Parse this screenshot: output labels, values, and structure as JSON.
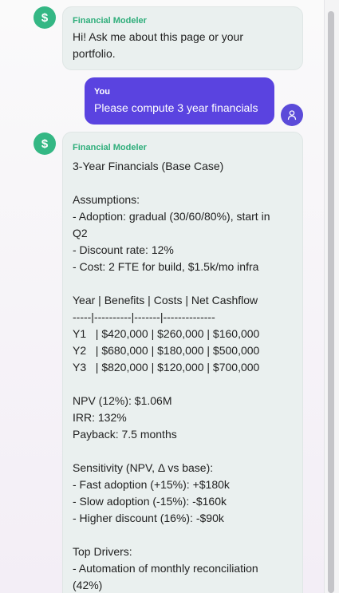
{
  "messages": [
    {
      "role": "assistant",
      "sender": "Financial Modeler",
      "avatar_icon": "dollar-sign-icon",
      "avatar_glyph": "$",
      "text": "Hi! Ask me about this page or your\nportfolio."
    },
    {
      "role": "user",
      "sender": "You",
      "avatar_icon": "user-icon",
      "text": "Please compute 3 year financials"
    },
    {
      "role": "assistant",
      "sender": "Financial Modeler",
      "avatar_icon": "dollar-sign-icon",
      "avatar_glyph": "$",
      "text": "3-Year Financials (Base Case)\n\nAssumptions:\n- Adoption: gradual (30/60/80%), start in\nQ2\n- Discount rate: 12%\n- Cost: 2 FTE for build, $1.5k/mo infra\n\nYear | Benefits | Costs | Net Cashflow\n-----|----------|-------|--------------\nY1   | $420,000 | $260,000 | $160,000\nY2   | $680,000 | $180,000 | $500,000\nY3   | $820,000 | $120,000 | $700,000\n\nNPV (12%): $1.06M\nIRR: 132%\nPayback: 7.5 months\n\nSensitivity (NPV, Δ vs base):\n- Fast adoption (+15%): +$180k\n- Slow adoption (-15%): -$160k\n- Higher discount (16%): -$90k\n\nTop Drivers:\n- Automation of monthly reconciliation\n(42%)"
    }
  ],
  "colors": {
    "assistant_avatar": "#34b784",
    "assistant_sender": "#2fae7b",
    "assistant_bubble": "#eaf0ef",
    "user_bubble": "#5a43e0",
    "user_avatar": "#5b4bd9"
  }
}
